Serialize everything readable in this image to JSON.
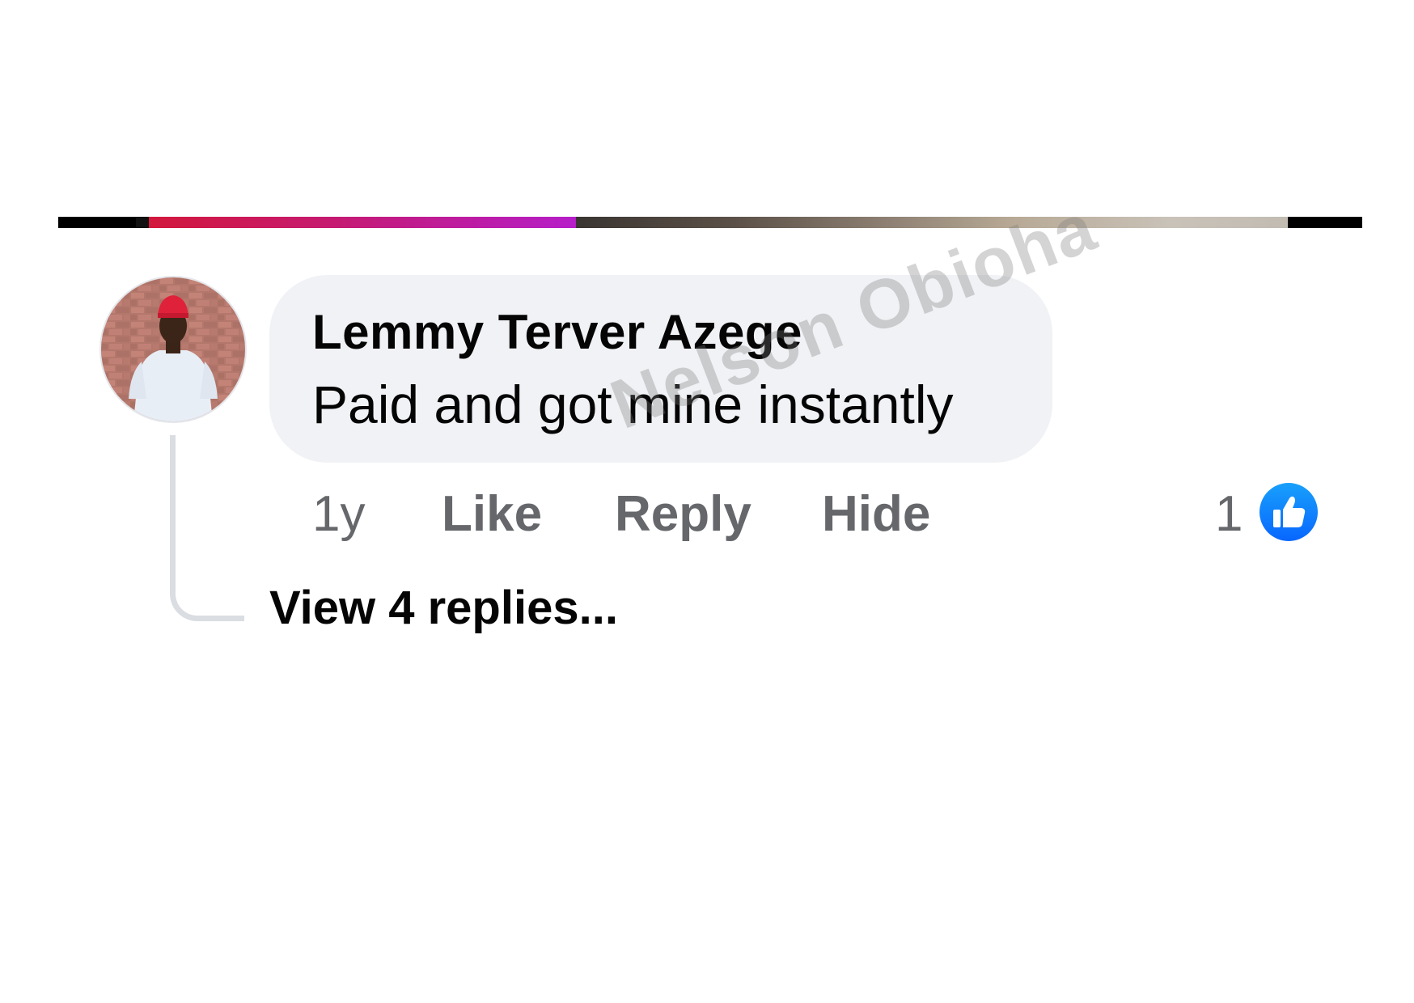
{
  "media": {
    "accent_colors": [
      "#d2183c",
      "#b61ec9"
    ]
  },
  "comment": {
    "author": "Lemmy Terver Azege",
    "text": "Paid and got mine instantly",
    "avatar_icon": "profile-photo",
    "bubble_color": "#f0f2f5"
  },
  "actions": {
    "time": "1y",
    "like_label": "Like",
    "reply_label": "Reply",
    "hide_label": "Hide"
  },
  "reactions": {
    "count": "1",
    "icon": "thumbs-up-icon",
    "badge_color": "#1877f2"
  },
  "replies": {
    "view_label": "View 4 replies..."
  },
  "watermark": {
    "text": "Nelson Obioha"
  }
}
